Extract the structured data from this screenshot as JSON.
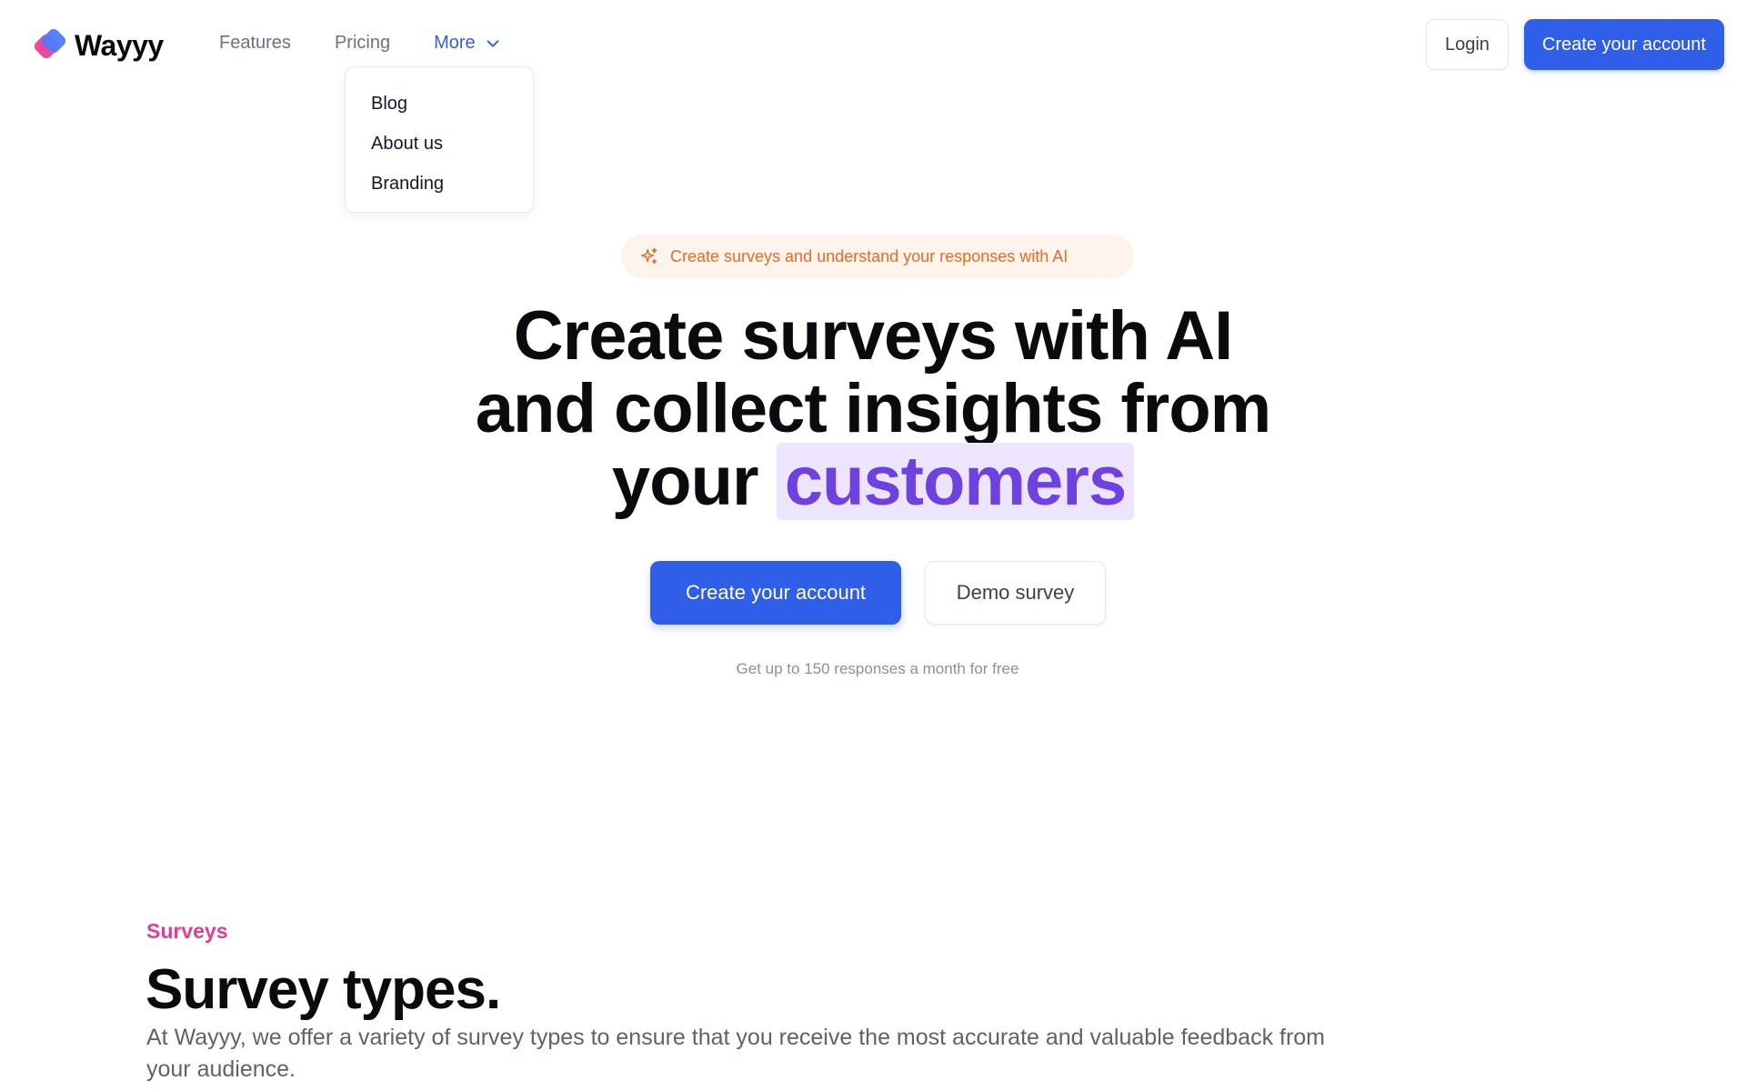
{
  "brand": {
    "name": "Wayyy",
    "colors": {
      "pink": "#ec4899",
      "blue": "#4f7bf7"
    }
  },
  "nav": {
    "links": [
      {
        "label": "Features"
      },
      {
        "label": "Pricing"
      },
      {
        "label": "More",
        "active": true,
        "icon": "chevron-down-icon"
      }
    ],
    "dropdown": [
      "Blog",
      "About us",
      "Branding"
    ],
    "login_label": "Login",
    "create_account_label": "Create your account"
  },
  "hero": {
    "pill_text": "Create surveys and understand your responses with AI",
    "pill_icon": "sparkle-icon",
    "headline_line1": "Create surveys with AI",
    "headline_line2": "and collect insights from",
    "headline_line3_prefix": "your",
    "headline_highlight": "customers",
    "primary_cta": "Create your account",
    "secondary_cta": "Demo survey",
    "subnote": "Get up to 150 responses a month for free"
  },
  "surveys_section": {
    "eyebrow": "Surveys",
    "title": "Survey types.",
    "description": "At Wayyy, we offer a variety of survey types to ensure that you receive the most accurate and valuable feedback from your audience."
  },
  "colors": {
    "primary": "#2f5fe8",
    "accent_orange": "#ea6a2a",
    "highlight_bg": "#ede5fd",
    "highlight_text": "#6d42e0",
    "eyebrow_pink": "#e23c93"
  }
}
